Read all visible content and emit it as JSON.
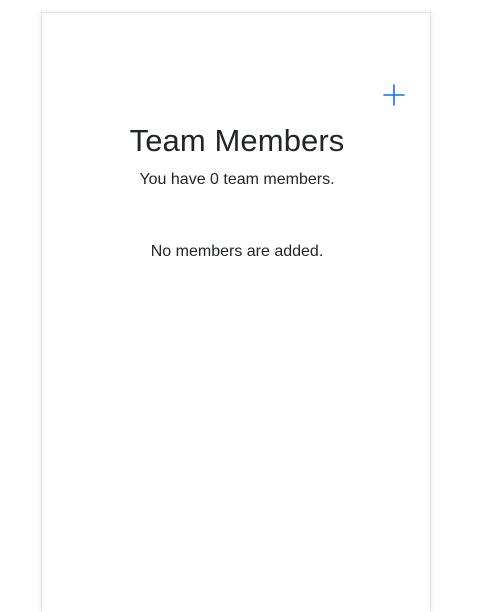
{
  "header": {
    "title": "Team Members",
    "subtitle": "You have 0 team members.",
    "add_icon": "plus-icon",
    "accent_color": "#0d6efd"
  },
  "members": {
    "count": 0,
    "items": [],
    "empty_message": "No members are added."
  }
}
